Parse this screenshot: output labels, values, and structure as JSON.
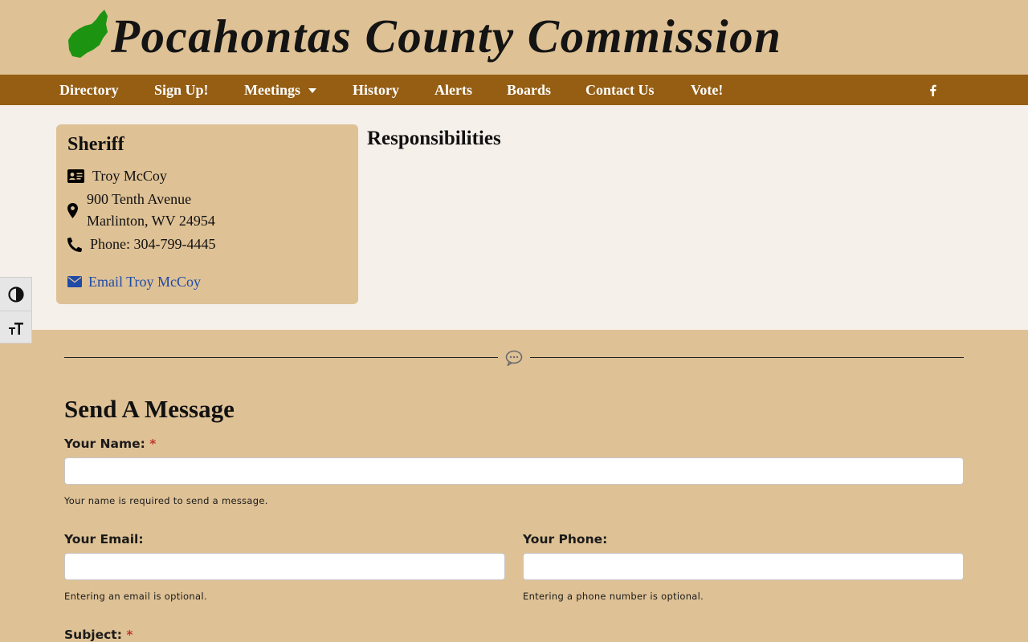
{
  "site": {
    "title": "Pocahontas County Commission",
    "colors": {
      "header_bg": "#dec195",
      "nav_bg": "#955e13",
      "content_bg": "#f6f0ea",
      "leaf": "#1c9412",
      "link": "#1e4aa8"
    }
  },
  "nav": {
    "items": [
      "Directory",
      "Sign Up!",
      "Meetings",
      "History",
      "Alerts",
      "Boards",
      "Contact Us",
      "Vote!"
    ],
    "social_icon": "facebook-icon"
  },
  "official": {
    "title": "Sheriff",
    "name": "Troy McCoy",
    "address_line1": "900 Tenth Avenue",
    "address_line2": "Marlinton, WV 24954",
    "phone": "Phone: 304-799-4445",
    "email_link": "Email Troy McCoy"
  },
  "responsibilities": {
    "heading": "Responsibilities"
  },
  "accessibility": {
    "contrast_icon": "contrast-icon",
    "font_size_icon": "text-size-icon"
  },
  "form": {
    "title": "Send A Message",
    "name_label": "Your Name:",
    "name_help": "Your name is required to send a message.",
    "email_label": "Your Email:",
    "email_help": "Entering an email is optional.",
    "phone_label": "Your Phone:",
    "phone_help": "Entering a phone number is optional.",
    "subject_label": "Subject:",
    "required_mark": "*"
  }
}
